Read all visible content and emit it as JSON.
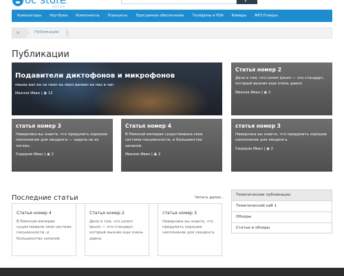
{
  "header": {
    "logo_text": "oc store",
    "logo_sub": "интернет-магазин",
    "search_placeholder": "",
    "search_icon": "search-icon"
  },
  "nav": {
    "items": [
      "Компьютеры",
      "Ноутбуки",
      "Компоненты",
      "Планшеты",
      "Програмное обеспечение",
      "Телефоны и PDA",
      "Камеры",
      "MP3 Плееры"
    ]
  },
  "breadcrumb": {
    "home_icon": "home-icon",
    "current": "Публикации"
  },
  "page": {
    "title": "Публикации"
  },
  "featured": [
    {
      "title": "Подавители диктофонов и микрофонов",
      "desc": "мвыва вап ва па пвап ва пвап вапвап ва пва в пвп",
      "author": "Иванов Иван",
      "views": "12"
    },
    {
      "title": "Статья номер 2",
      "desc": "Дело в том, что Lorem Ipsum — это стандарт, который вызник еще очень давно.",
      "author": "Иванов Иван",
      "views": "2"
    },
    {
      "title": "статья номер 3",
      "desc": "Наверняка вы знаете, что придумать хорошее наполнение для лендинга — задача не из легких.",
      "author": "Сидоров Иван",
      "views": "2"
    },
    {
      "title": "Статья номер 4",
      "desc": "В Римской империи существовала своя система письменности, и большинство записей.",
      "author": "Иванов Иван",
      "views": "2"
    },
    {
      "title": "статья номер 3",
      "desc": "Наверняка вы знаете, что придумать хорошее наполнение для лендинга.",
      "author": "Сидоров Иван",
      "views": "2"
    }
  ],
  "latest": {
    "title": "Последние статьи",
    "read_more": "Читать далее...",
    "posts": [
      {
        "title": "Статья номер 4",
        "desc": "В Римской империи существовала своя система письменности, и большинство записей."
      },
      {
        "title": "Статья номер 2",
        "desc": "Дело в том, что Lorem Ipsum — это стандарт, который вызник еще очень давно."
      },
      {
        "title": "статья номер 3",
        "desc": "Наверняка вы знаете, что придумать хорошее наполнение для лендинга."
      }
    ]
  },
  "sidebar": {
    "items": [
      "Тематические публикации",
      "Тематический хаб 1",
      "Обзоры",
      "Статьи и обзоры"
    ]
  }
}
